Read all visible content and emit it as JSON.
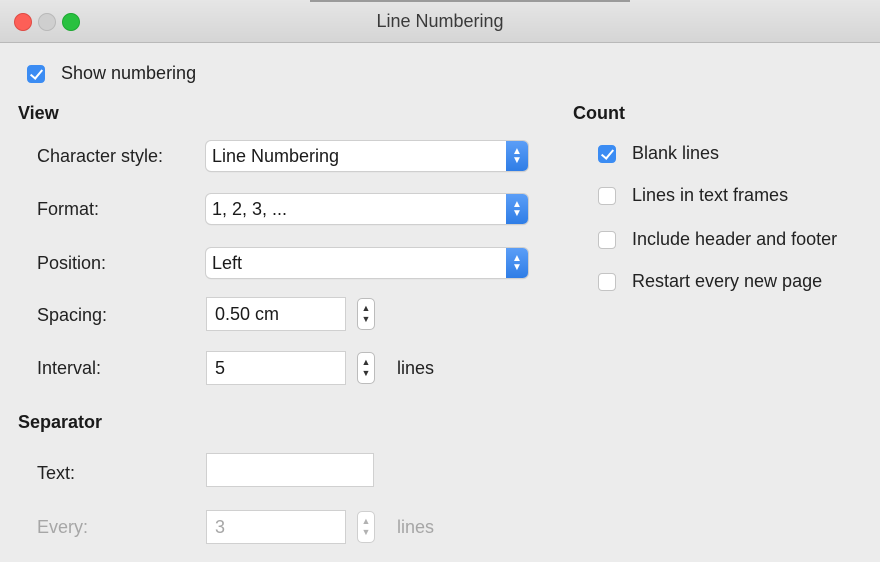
{
  "window": {
    "title": "Line Numbering"
  },
  "show_numbering": {
    "label": "Show numbering",
    "checked": true
  },
  "view": {
    "heading": "View",
    "character_style": {
      "label": "Character style:",
      "value": "Line Numbering"
    },
    "format": {
      "label": "Format:",
      "value": "1, 2, 3, ..."
    },
    "position": {
      "label": "Position:",
      "value": "Left"
    },
    "spacing": {
      "label": "Spacing:",
      "value": "0.50 cm"
    },
    "interval": {
      "label": "Interval:",
      "value": "5",
      "unit": "lines"
    }
  },
  "separator": {
    "heading": "Separator",
    "text": {
      "label": "Text:",
      "value": ""
    },
    "every": {
      "label": "Every:",
      "value": "3",
      "unit": "lines"
    }
  },
  "count": {
    "heading": "Count",
    "items": [
      {
        "label": "Blank lines",
        "checked": true
      },
      {
        "label": "Lines in text frames",
        "checked": false
      },
      {
        "label": "Include header and footer",
        "checked": false
      },
      {
        "label": "Restart every new page",
        "checked": false
      }
    ]
  },
  "colors": {
    "accent": "#3b8cf3",
    "window_bg": "#ececec",
    "disabled_text": "#a6a6a6"
  }
}
